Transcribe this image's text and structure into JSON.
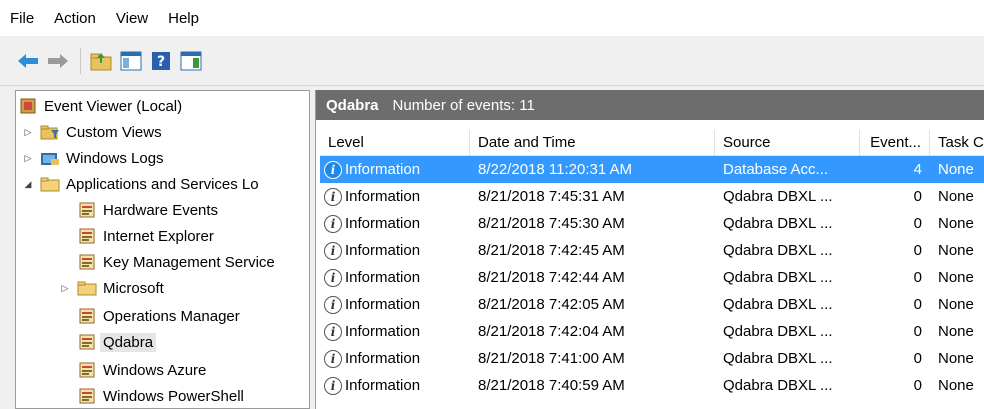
{
  "menu": {
    "items": [
      "File",
      "Action",
      "View",
      "Help"
    ]
  },
  "toolbar": {
    "buttons": [
      "back-arrow-icon",
      "forward-arrow-icon",
      "up-folder-icon",
      "show-hide-tree-icon",
      "help-icon",
      "show-hide-action-pane-icon"
    ]
  },
  "tree": {
    "items": [
      {
        "label": "Event Viewer (Local)",
        "icon": "event-viewer-icon",
        "expander": "",
        "depth": 0
      },
      {
        "label": "Custom Views",
        "icon": "folder-filter-icon",
        "expander": "▷",
        "depth": 1
      },
      {
        "label": "Windows Logs",
        "icon": "windows-logs-icon",
        "expander": "▷",
        "depth": 1
      },
      {
        "label": "Applications and Services Lo",
        "icon": "folder-icon",
        "expander": "◢",
        "depth": 1
      },
      {
        "label": "Hardware Events",
        "icon": "log-icon",
        "expander": "",
        "depth": 2
      },
      {
        "label": "Internet Explorer",
        "icon": "log-icon",
        "expander": "",
        "depth": 2
      },
      {
        "label": "Key Management Service",
        "icon": "log-icon",
        "expander": "",
        "depth": 2
      },
      {
        "label": "Microsoft",
        "icon": "folder-icon",
        "expander": "▷",
        "depth": 2
      },
      {
        "label": "Operations Manager",
        "icon": "log-icon",
        "expander": "",
        "depth": 2
      },
      {
        "label": "Qdabra",
        "icon": "log-icon",
        "expander": "",
        "depth": 2,
        "selected": true
      },
      {
        "label": "Windows Azure",
        "icon": "log-icon",
        "expander": "",
        "depth": 2
      },
      {
        "label": "Windows PowerShell",
        "icon": "log-icon",
        "expander": "",
        "depth": 2
      }
    ]
  },
  "panel": {
    "title": "Qdabra",
    "count_label": "Number of events: 11",
    "columns": [
      "Level",
      "Date and Time",
      "Source",
      "Event...",
      "Task C"
    ],
    "rows": [
      {
        "level": "Information",
        "date": "8/22/2018 11:20:31 AM",
        "source": "Database Acc...",
        "event": "4",
        "task": "None",
        "selected": true
      },
      {
        "level": "Information",
        "date": "8/21/2018 7:45:31 AM",
        "source": "Qdabra DBXL ...",
        "event": "0",
        "task": "None"
      },
      {
        "level": "Information",
        "date": "8/21/2018 7:45:30 AM",
        "source": "Qdabra DBXL ...",
        "event": "0",
        "task": "None"
      },
      {
        "level": "Information",
        "date": "8/21/2018 7:42:45 AM",
        "source": "Qdabra DBXL ...",
        "event": "0",
        "task": "None"
      },
      {
        "level": "Information",
        "date": "8/21/2018 7:42:44 AM",
        "source": "Qdabra DBXL ...",
        "event": "0",
        "task": "None"
      },
      {
        "level": "Information",
        "date": "8/21/2018 7:42:05 AM",
        "source": "Qdabra DBXL ...",
        "event": "0",
        "task": "None"
      },
      {
        "level": "Information",
        "date": "8/21/2018 7:42:04 AM",
        "source": "Qdabra DBXL ...",
        "event": "0",
        "task": "None"
      },
      {
        "level": "Information",
        "date": "8/21/2018 7:41:00 AM",
        "source": "Qdabra DBXL ...",
        "event": "0",
        "task": "None"
      },
      {
        "level": "Information",
        "date": "8/21/2018 7:40:59 AM",
        "source": "Qdabra DBXL ...",
        "event": "0",
        "task": "None"
      }
    ]
  },
  "colors": {
    "selection": "#3399ff",
    "panel_header": "#6d6d6d",
    "tree_selected": "#e5e5e5"
  }
}
